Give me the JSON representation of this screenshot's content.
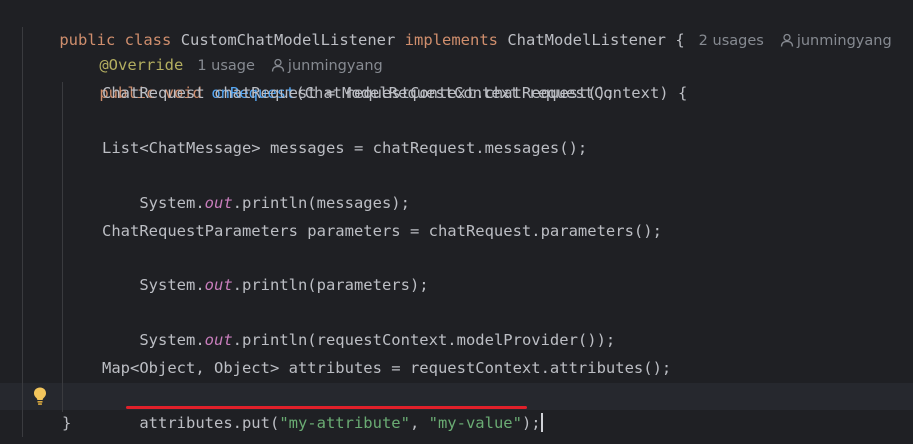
{
  "code": {
    "line1": {
      "kw_public": "public",
      "kw_class": "class",
      "class_name": "CustomChatModelListener",
      "kw_implements": "implements",
      "interface_name": "ChatModelListener",
      "brace": "{",
      "usages": "2 usages",
      "author": "junmingyang"
    },
    "line2": {
      "annotation": "@Override",
      "usages": "1 usage",
      "author": "junmingyang"
    },
    "line3": {
      "kw_public": "public",
      "kw_void": "void",
      "method_name": "onRequest",
      "params": "(ChatModelRequestContext requestContext) {"
    },
    "line4": "ChatRequest chatRequest = requestContext.chatRequest();",
    "line6": "List<ChatMessage> messages = chatRequest.messages();",
    "line7": {
      "prefix": "System.",
      "field": "out",
      "suffix": ".println(messages);"
    },
    "line9": "ChatRequestParameters parameters = chatRequest.parameters();",
    "line10": {
      "prefix": "System.",
      "field": "out",
      "suffix": ".println(parameters);"
    },
    "line12": {
      "prefix": "System.",
      "field": "out",
      "suffix": ".println(requestContext.modelProvider());"
    },
    "line14": "Map<Object, Object> attributes = requestContext.attributes();",
    "line15": {
      "prefix": "attributes.put(",
      "str1": "\"my-attribute\"",
      "comma": ", ",
      "str2": "\"my-value\"",
      "suffix": ");"
    },
    "line16": "}"
  },
  "icons": {
    "usage_author": "user-icon",
    "intention": "lightbulb-icon"
  },
  "colors": {
    "background": "#1f2024",
    "keyword": "#cf8e6d",
    "annotation": "#b3ae60",
    "method": "#56a8f5",
    "static_field": "#c77dbb",
    "string": "#6aab73",
    "text": "#bcbec4",
    "hint": "#868a91",
    "highlight_underline": "#e0202a"
  }
}
